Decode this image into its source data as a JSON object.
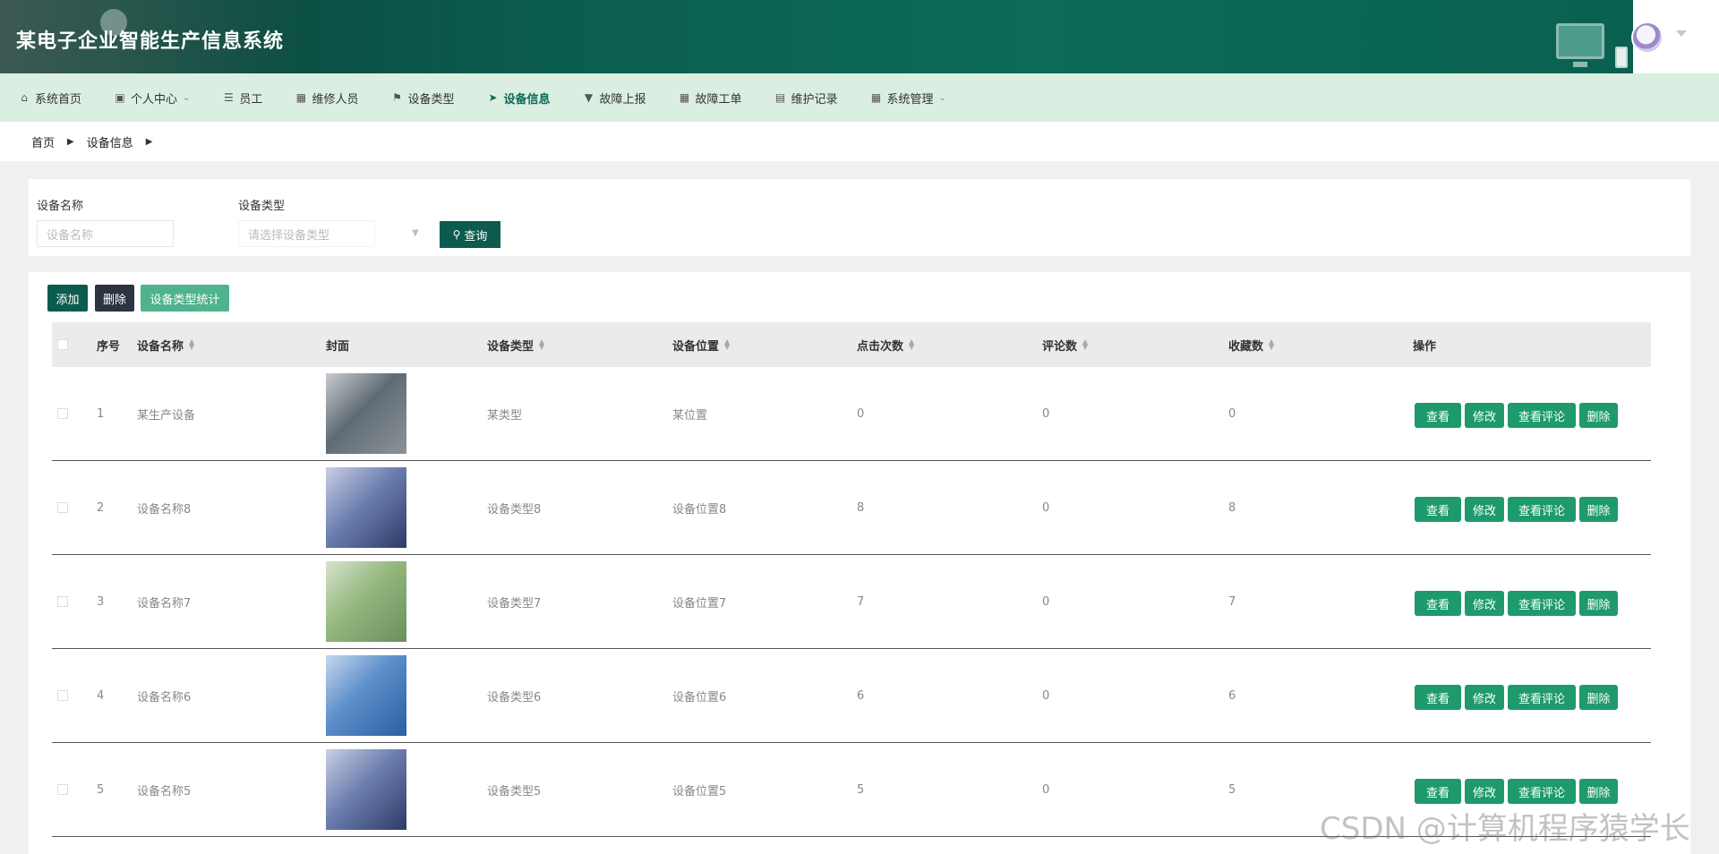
{
  "header": {
    "title": "某电子企业智能生产信息系统"
  },
  "nav": {
    "items": [
      {
        "label": "系统首页",
        "icon": "home-icon"
      },
      {
        "label": "个人中心",
        "icon": "card-icon",
        "dropdown": true
      },
      {
        "label": "员工",
        "icon": "list-icon"
      },
      {
        "label": "维修人员",
        "icon": "grid-icon"
      },
      {
        "label": "设备类型",
        "icon": "flag-icon"
      },
      {
        "label": "设备信息",
        "icon": "send-icon",
        "active": true
      },
      {
        "label": "故障上报",
        "icon": "pin-icon"
      },
      {
        "label": "故障工单",
        "icon": "grid-icon"
      },
      {
        "label": "维护记录",
        "icon": "clipboard-icon"
      },
      {
        "label": "系统管理",
        "icon": "grid-icon",
        "dropdown": true
      }
    ]
  },
  "breadcrumb": {
    "home": "首页",
    "current": "设备信息"
  },
  "search": {
    "name_label": "设备名称",
    "name_placeholder": "设备名称",
    "type_label": "设备类型",
    "type_placeholder": "请选择设备类型",
    "query_label": "查询"
  },
  "toolbar": {
    "add": "添加",
    "delete": "删除",
    "stat": "设备类型统计"
  },
  "table": {
    "headers": {
      "index": "序号",
      "name": "设备名称",
      "cover": "封面",
      "type": "设备类型",
      "location": "设备位置",
      "clicks": "点击次数",
      "comments": "评论数",
      "favorites": "收藏数",
      "actions": "操作"
    },
    "actions": {
      "view": "查看",
      "edit": "修改",
      "view_comments": "查看评论",
      "delete": "删除"
    },
    "rows": [
      {
        "index": "1",
        "name": "某生产设备",
        "type": "某类型",
        "location": "某位置",
        "clicks": "0",
        "comments": "0",
        "favorites": "0"
      },
      {
        "index": "2",
        "name": "设备名称8",
        "type": "设备类型8",
        "location": "设备位置8",
        "clicks": "8",
        "comments": "0",
        "favorites": "8"
      },
      {
        "index": "3",
        "name": "设备名称7",
        "type": "设备类型7",
        "location": "设备位置7",
        "clicks": "7",
        "comments": "0",
        "favorites": "7"
      },
      {
        "index": "4",
        "name": "设备名称6",
        "type": "设备类型6",
        "location": "设备位置6",
        "clicks": "6",
        "comments": "0",
        "favorites": "6"
      },
      {
        "index": "5",
        "name": "设备名称5",
        "type": "设备类型5",
        "location": "设备位置5",
        "clicks": "5",
        "comments": "0",
        "favorites": "5"
      }
    ]
  },
  "watermark": "CSDN @计算机程序猿学长"
}
